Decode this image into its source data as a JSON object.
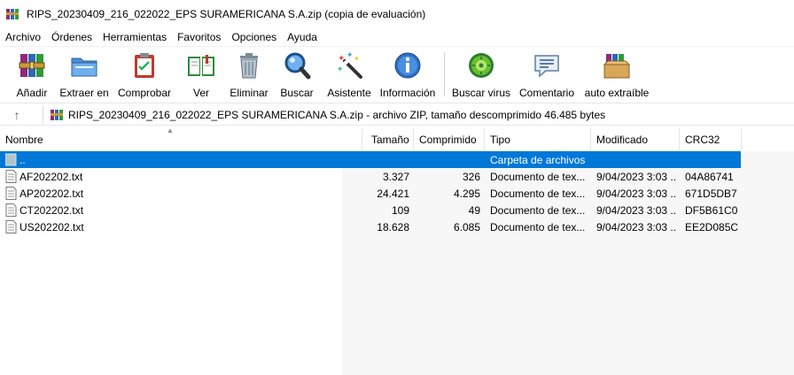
{
  "window": {
    "title": "RIPS_20230409_216_022022_EPS SURAMERICANA S.A.zip (copia de evaluación)"
  },
  "menu": [
    "Archivo",
    "Órdenes",
    "Herramientas",
    "Favoritos",
    "Opciones",
    "Ayuda"
  ],
  "toolbar": {
    "add": "Añadir",
    "extract": "Extraer en",
    "test": "Comprobar",
    "view": "Ver",
    "delete": "Eliminar",
    "find": "Buscar",
    "wizard": "Asistente",
    "info": "Información",
    "virus": "Buscar virus",
    "comment": "Comentario",
    "sfx": "auto extraíble"
  },
  "address": {
    "path": "RIPS_20230409_216_022022_EPS SURAMERICANA S.A.zip - archivo ZIP, tamaño descomprimido 46.485 bytes"
  },
  "columns": {
    "name": "Nombre",
    "size": "Tamaño",
    "packed": "Comprimido",
    "type": "Tipo",
    "modified": "Modificado",
    "crc": "CRC32"
  },
  "parent_row": {
    "name": "..",
    "type": "Carpeta de archivos"
  },
  "files": [
    {
      "name": "AF202202.txt",
      "size": "3.327",
      "packed": "326",
      "type": "Documento de tex...",
      "modified": "9/04/2023 3:03 ...",
      "crc": "04A86741"
    },
    {
      "name": "AP202202.txt",
      "size": "24.421",
      "packed": "4.295",
      "type": "Documento de tex...",
      "modified": "9/04/2023 3:03 ...",
      "crc": "671D5DB7"
    },
    {
      "name": "CT202202.txt",
      "size": "109",
      "packed": "49",
      "type": "Documento de tex...",
      "modified": "9/04/2023 3:03 ...",
      "crc": "DF5B61C0"
    },
    {
      "name": "US202202.txt",
      "size": "18.628",
      "packed": "6.085",
      "type": "Documento de tex...",
      "modified": "9/04/2023 3:03 ...",
      "crc": "EE2D085C"
    }
  ],
  "colors": {
    "selection": "#0078d7",
    "right_pane_bg": "#f7f7f7"
  }
}
